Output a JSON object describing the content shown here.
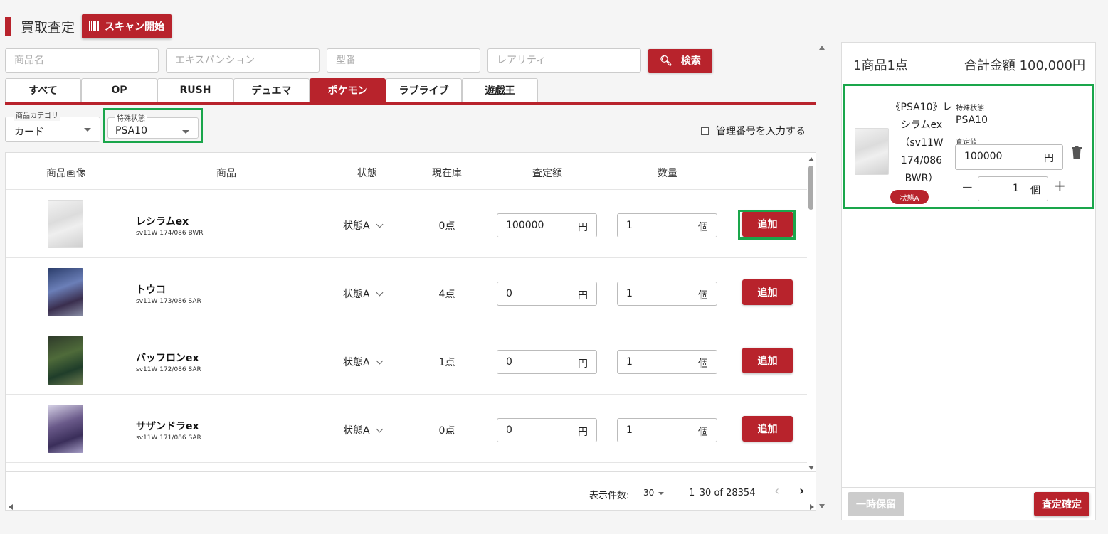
{
  "header": {
    "title": "買取査定",
    "scan_label": "スキャン開始"
  },
  "search": {
    "name_placeholder": "商品名",
    "expansion_placeholder": "エキスパンション",
    "model_placeholder": "型番",
    "rarity_placeholder": "レアリティ",
    "button_label": "検索"
  },
  "tabs": [
    "すべて",
    "OP",
    "RUSH",
    "デュエマ",
    "ポケモン",
    "ラブライブ",
    "遊戯王"
  ],
  "active_tab": "ポケモン",
  "filters": {
    "category_label": "商品カテゴリ",
    "category_value": "カード",
    "special_label": "特殊状態",
    "special_value": "PSA10",
    "mgmt_label": "管理番号を入力する"
  },
  "table": {
    "headers": {
      "image": "商品画像",
      "product": "商品",
      "condition": "状態",
      "stock": "現在庫",
      "price": "査定額",
      "quantity": "数量"
    },
    "rows": [
      {
        "name": "レシラムex",
        "code": "sv11W 174/086 BWR",
        "condition": "状態A",
        "stock": "0点",
        "price": "100000",
        "price_unit": "円",
        "qty": "1",
        "qty_unit": "個",
        "add": "追加"
      },
      {
        "name": "トウコ",
        "code": "sv11W 173/086 SAR",
        "condition": "状態A",
        "stock": "4点",
        "price": "0",
        "price_unit": "円",
        "qty": "1",
        "qty_unit": "個",
        "add": "追加"
      },
      {
        "name": "バッフロンex",
        "code": "sv11W 172/086 SAR",
        "condition": "状態A",
        "stock": "1点",
        "price": "0",
        "price_unit": "円",
        "qty": "1",
        "qty_unit": "個",
        "add": "追加"
      },
      {
        "name": "サザンドラex",
        "code": "sv11W 171/086 SAR",
        "condition": "状態A",
        "stock": "0点",
        "price": "0",
        "price_unit": "円",
        "qty": "1",
        "qty_unit": "個",
        "add": "追加"
      }
    ]
  },
  "pager": {
    "label": "表示件数:",
    "per_page": "30",
    "range": "1–30 of 28354",
    "prev": "‹",
    "next": "›"
  },
  "cart": {
    "count": "1商品1点",
    "total": "合計金額 100,000円",
    "item": {
      "name": "《PSA10》レシラムex（sv11W 174/086 BWR）",
      "badge": "状態A",
      "special_label": "特殊状態",
      "special_value": "PSA10",
      "price_label": "査定値",
      "price": "100000",
      "price_unit": "円",
      "minus": "−",
      "qty": "1",
      "qty_unit": "個",
      "plus": "+"
    },
    "hold_label": "一時保留",
    "confirm_label": "査定確定"
  },
  "colors": {
    "accent": "#b8232c",
    "highlight": "#1aa64b"
  }
}
